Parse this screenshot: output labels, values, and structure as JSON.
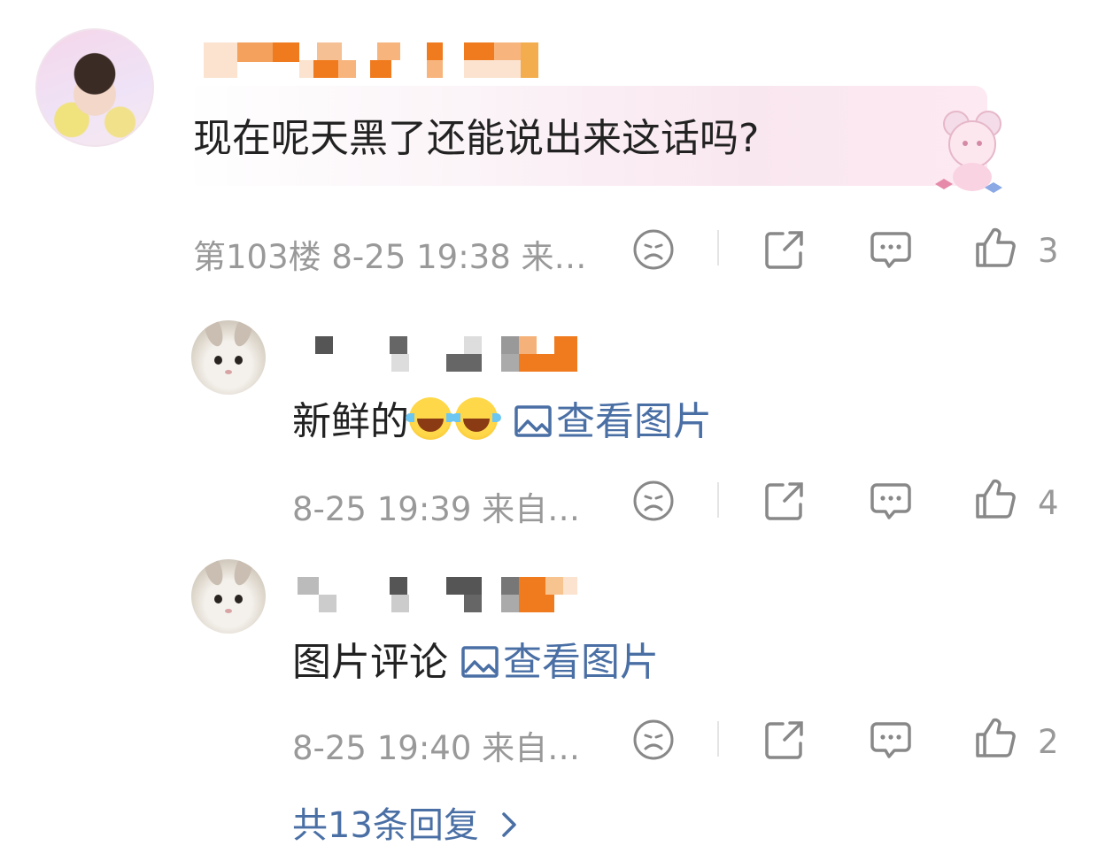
{
  "main_comment": {
    "text": "现在呢天黑了还能说出来这话吗?",
    "meta": "第103楼 8-25 19:38 来…",
    "like_count": "3"
  },
  "replies": [
    {
      "text": "新鲜的",
      "emoji": "laugh-cry-emoji",
      "view_picture": "查看图片",
      "meta": "8-25 19:39 来自…",
      "like_count": "4"
    },
    {
      "text": "图片评论 ",
      "view_picture": "查看图片",
      "meta": "8-25 19:40 来自…",
      "like_count": "2"
    }
  ],
  "more_replies": "共13条回复",
  "icons": {
    "dislike": "sad-face-icon",
    "share": "share-icon",
    "comment": "comment-icon",
    "like": "thumbs-up-icon",
    "picture": "image-icon",
    "chevron": "chevron-right-icon"
  },
  "colors": {
    "link": "#4a6fa5",
    "meta": "#999999",
    "mosaic_orange": "#f07a1e"
  }
}
